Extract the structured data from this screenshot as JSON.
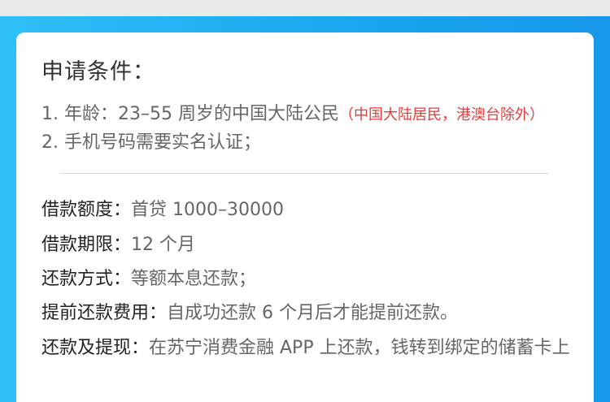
{
  "section": {
    "title": "申请条件："
  },
  "conditions": [
    {
      "text": "1. 年龄：23–55 周岁的中国大陆公民",
      "note": "（中国大陆居民，港澳台除外）"
    },
    {
      "text": "2. 手机号码需要实名认证；"
    }
  ],
  "details": [
    {
      "label": "借款额度：",
      "value": "首贷 1000–30000"
    },
    {
      "label": "借款期限：",
      "value": "12 个月"
    },
    {
      "label": "还款方式：",
      "value": "等额本息还款；"
    },
    {
      "label": "提前还款费用：",
      "value": "自成功还款 6 个月后才能提前还款。"
    },
    {
      "label": "还款及提现：",
      "value": "在苏宁消费金融 APP 上还款，钱转到绑定的储蓄卡上"
    }
  ],
  "colors": {
    "header_blue": "#1aa8ef",
    "note_red": "#e93b3b"
  }
}
